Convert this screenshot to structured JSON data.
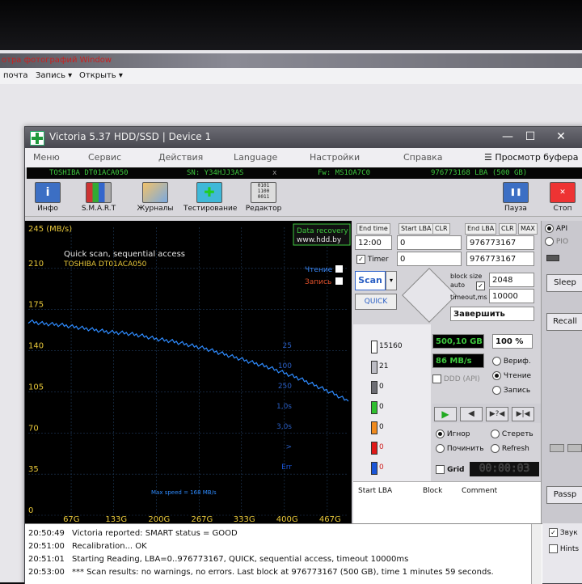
{
  "background": {
    "title_fragment": "отра фотографий Window",
    "menu": [
      "почта",
      "Запись ▾",
      "Открыть ▾"
    ]
  },
  "window": {
    "title": "Victoria 5.37 HDD/SSD | Device 1",
    "controls": [
      "—",
      "☐",
      "✕"
    ]
  },
  "menu": [
    "Меню",
    "Сервис",
    "Действия",
    "Language",
    "Настройки",
    "Справка"
  ],
  "buffer_view": "Просмотр буфера",
  "drive": {
    "model": "TOSHIBA DT01ACA050",
    "serial": "SN: Y34HJJ3AS",
    "x": "x",
    "firmware": "Fw: MS1OA7C0",
    "capacity": "976773168 LBA (500 GB)"
  },
  "toolbar": [
    "Инфо",
    "S.M.A.R.T",
    "Журналы",
    "Тестирование",
    "Редактор"
  ],
  "pause_label": "Пауза",
  "stop_label": "Стоп",
  "graph": {
    "y_unit": "245 (MB/s)",
    "title": "Quick scan, sequential access",
    "drive": "TOSHIBA DT01ACA050",
    "ad_line1": "Data recovery",
    "ad_line2": "www.hdd.by",
    "read_label": "Чтение",
    "write_label": "Запись",
    "max_speed": "Max speed = 168 MB/s",
    "y_ticks": [
      "210",
      "175",
      "140",
      "105",
      "70",
      "35",
      "0"
    ],
    "x_ticks": [
      "67G",
      "133G",
      "200G",
      "267G",
      "333G",
      "400G",
      "467G"
    ]
  },
  "chart_data": {
    "type": "line",
    "title": "Quick scan, sequential access",
    "ylabel": "MB/s",
    "ylim": [
      0,
      245
    ],
    "x_unit": "GB",
    "series": [
      {
        "name": "Чтение",
        "x": [
          0,
          25,
          50,
          75,
          100,
          125,
          150,
          175,
          200,
          225,
          250,
          275,
          300,
          325,
          350,
          375,
          400,
          425,
          450,
          475,
          500
        ],
        "values": [
          165,
          163,
          162,
          160,
          158,
          156,
          155,
          153,
          150,
          148,
          145,
          142,
          138,
          134,
          130,
          126,
          121,
          116,
          110,
          104,
          97
        ]
      }
    ]
  },
  "controls": {
    "end_time_lbl": "End time",
    "start_lba_lbl": "Start LBA",
    "end_lba_lbl": "End LBA",
    "clr": "CLR",
    "max": "MAX",
    "time": "12:00",
    "start_lba": "0",
    "end_lba": "976773167",
    "timer_lbl": "Timer",
    "timer_val": "0",
    "end_lba2": "976773167",
    "scan": "Scan",
    "quick": "QUICK",
    "block_size_lbl": "block size",
    "auto_lbl": "auto",
    "timeout_lbl": "timeout,ms",
    "block_size": "2048",
    "timeout": "10000",
    "action": "Завершить"
  },
  "legend": [
    {
      "label": "25",
      "count": "15160",
      "color": "#ffffff"
    },
    {
      "label": "100",
      "count": "21",
      "color": "#bcbcc4"
    },
    {
      "label": "250",
      "count": "0",
      "color": "#6d6d74"
    },
    {
      "label": "1,0s",
      "count": "0",
      "color": "#2fbf2f"
    },
    {
      "label": "3,0s",
      "count": "0",
      "color": "#f08a1e"
    },
    {
      "label": ">",
      "count": "0",
      "color": "#e01818"
    },
    {
      "label": "Err",
      "count": "0",
      "color": "#1a55d8"
    }
  ],
  "status": {
    "position": "500,10 GB",
    "percent": "100",
    "percent_sign": "%",
    "speed": "86 MB/s",
    "ddd": "DDD (API)",
    "verify": "Вериф.",
    "read": "Чтение",
    "write": "Запись",
    "ignore": "Игнор",
    "erase": "Стереть",
    "repair": "Починить",
    "refresh": "Refresh",
    "grid": "Grid",
    "timer": "00:00:03"
  },
  "table_headers": [
    "Start LBA",
    "Block",
    "Comment"
  ],
  "side": {
    "api": "API",
    "pio": "PIO",
    "sleep": "Sleep",
    "recall": "Recall",
    "passp": "Passp",
    "sound": "Звук",
    "hints": "Hints"
  },
  "log": [
    {
      "time": "20:50:49",
      "text": "Victoria reported: SMART status = GOOD"
    },
    {
      "time": "20:51:00",
      "text": "Recalibration... OK"
    },
    {
      "time": "20:51:01",
      "text": "Starting Reading, LBA=0..976773167, QUICK, sequential access, timeout 10000ms"
    },
    {
      "time": "20:53:00",
      "text": "*** Scan results: no warnings, no errors. Last block at 976773167 (500 GB), time 1 minutes 59 seconds."
    }
  ]
}
